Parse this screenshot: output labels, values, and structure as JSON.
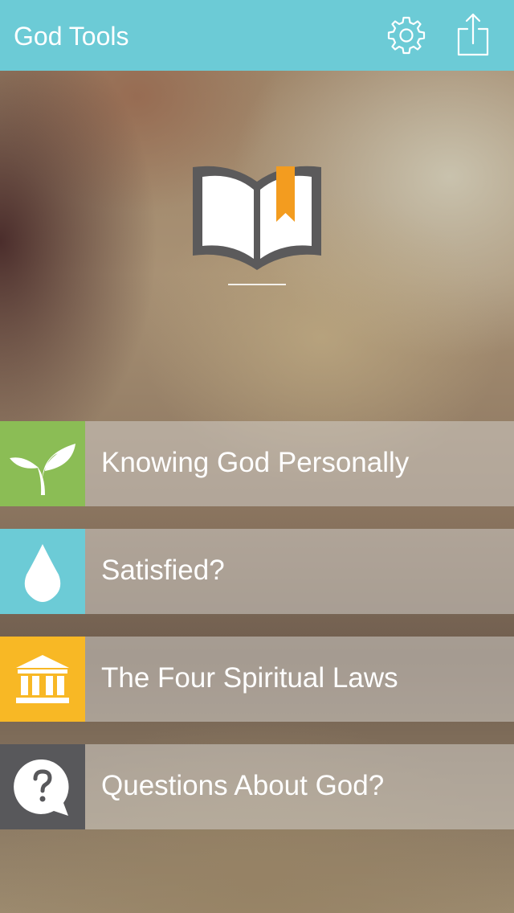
{
  "header": {
    "title": "God Tools",
    "settings_icon": "gear-icon",
    "share_icon": "share-icon",
    "background_color": "#6ccbd6"
  },
  "hero": {
    "logo_icon": "open-book-bookmark-icon",
    "bookmark_color": "#f39c1f"
  },
  "menu": {
    "items": [
      {
        "label": "Knowing God Personally",
        "icon": "sprout-icon",
        "icon_bg": "#8bbd55"
      },
      {
        "label": "Satisfied?",
        "icon": "water-drop-icon",
        "icon_bg": "#6ccbd6"
      },
      {
        "label": "The Four Spiritual Laws",
        "icon": "building-columns-icon",
        "icon_bg": "#f8b825"
      },
      {
        "label": "Questions About God?",
        "icon": "question-bubble-icon",
        "icon_bg": "#58585b"
      }
    ]
  }
}
